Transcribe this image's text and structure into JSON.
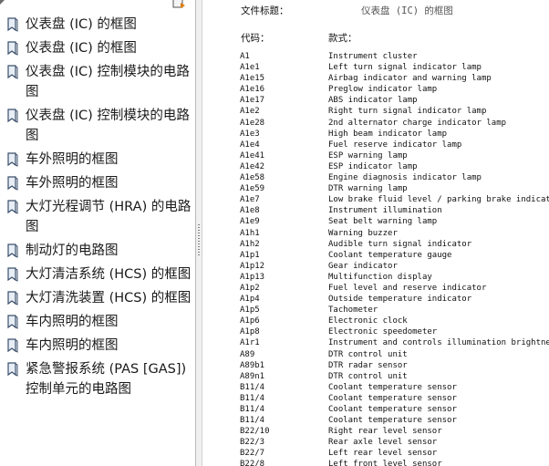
{
  "bookmarks": [
    "仪表盘 (IC) 的框图",
    "仪表盘 (IC) 的框图",
    "仪表盘 (IC) 控制模块的电路图",
    "仪表盘 (IC) 控制模块的电路图",
    "车外照明的框图",
    "车外照明的框图",
    "大灯光程调节 (HRA) 的电路图",
    "制动灯的电路图",
    "大灯清洁系统 (HCS) 的框图",
    "大灯清洗装置 (HCS) 的框图",
    "车内照明的框图",
    "车内照明的框图",
    "紧急警报系统 (PAS [GAS]) 控制单元的电路图"
  ],
  "document": {
    "title_label": "文件标题：",
    "title_value": "仪表盘 (IC) 的框图",
    "code_header": "代码：",
    "item_header": "款式：",
    "rows": [
      [
        "A1",
        "Instrument cluster"
      ],
      [
        "A1e1",
        "Left turn signal indicator lamp"
      ],
      [
        "A1e15",
        "Airbag indicator and warning lamp"
      ],
      [
        "A1e16",
        "Preglow indicator lamp"
      ],
      [
        "A1e17",
        "ABS indicator lamp"
      ],
      [
        "A1e2",
        "Right turn signal indicator lamp"
      ],
      [
        "A1e28",
        "2nd alternator charge indicator lamp"
      ],
      [
        "A1e3",
        "High beam indicator lamp"
      ],
      [
        "A1e4",
        "Fuel reserve indicator lamp"
      ],
      [
        "A1e41",
        "ESP warning lamp"
      ],
      [
        "A1e42",
        "ESP indicator lamp"
      ],
      [
        "A1e58",
        "Engine diagnosis indicator lamp"
      ],
      [
        "A1e59",
        "DTR warning lamp"
      ],
      [
        "A1e7",
        "Low brake fluid level / parking brake indicator lar"
      ],
      [
        "A1e8",
        "Instrument illumination"
      ],
      [
        "A1e9",
        "Seat belt warning lamp"
      ],
      [
        "A1h1",
        "Warning buzzer"
      ],
      [
        "A1h2",
        "Audible turn signal indicator"
      ],
      [
        "A1p1",
        "Coolant temperature gauge"
      ],
      [
        "A1p12",
        "Gear indicator"
      ],
      [
        "A1p13",
        "Multifunction display"
      ],
      [
        "A1p2",
        "Fuel level and reserve indicator"
      ],
      [
        "A1p4",
        "Outside temperature indicator"
      ],
      [
        "A1p5",
        "Tachometer"
      ],
      [
        "A1p6",
        "Electronic clock"
      ],
      [
        "A1p8",
        "Electronic speedometer"
      ],
      [
        "A1r1",
        "Instrument and controls illumination brightness cor"
      ],
      [
        "A89",
        "DTR control unit"
      ],
      [
        "A89b1",
        "DTR radar sensor"
      ],
      [
        "A89n1",
        "DTR control unit"
      ],
      [
        "B11/4",
        "Coolant temperature sensor"
      ],
      [
        "B11/4",
        "Coolant temperature sensor"
      ],
      [
        "B11/4",
        "Coolant temperature sensor"
      ],
      [
        "B11/4",
        "Coolant temperature sensor"
      ],
      [
        "B22/10",
        "Right rear level sensor"
      ],
      [
        "B22/3",
        "Rear axle level sensor"
      ],
      [
        "B22/7",
        "Left rear level sensor"
      ],
      [
        "B22/8",
        "Left front level sensor"
      ]
    ]
  }
}
